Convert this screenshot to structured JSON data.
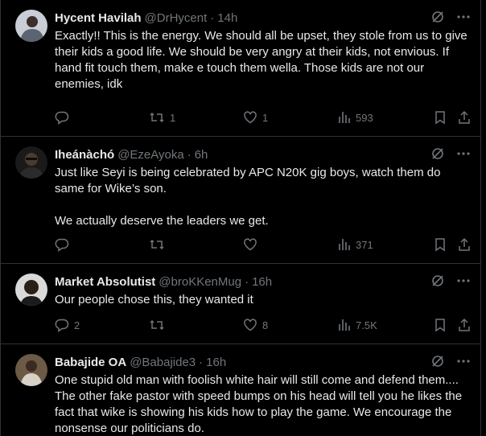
{
  "colors": {
    "background": "#000000",
    "text": "#e7e9ea",
    "muted": "#71767b",
    "border": "#2f3336"
  },
  "icons": {
    "grok": "grok-icon",
    "more": "more-icon",
    "reply": "reply-icon",
    "retweet": "retweet-icon",
    "like": "like-icon",
    "views": "views-icon",
    "bookmark": "bookmark-icon",
    "share": "share-icon"
  },
  "tweets": [
    {
      "name": "Hycent Havilah",
      "handle": "@DrHycent",
      "sep": "·",
      "time": "14h",
      "text": "Exactly!! This is the energy. We should all be upset, they stole from us to give their kids a good life. We should be very angry at their kids, not envious. If hand fit touch them, make e touch them wella. Those kids are not our enemies, idk",
      "replies": "",
      "retweets": "1",
      "likes": "1",
      "views": "593"
    },
    {
      "name": "Iheánàchó",
      "handle": "@EzeAyoka",
      "sep": "·",
      "time": "6h",
      "text": "Just like Seyi is being celebrated by APC N20K gig boys, watch them do same for Wike’s son.\n\nWe actually deserve the leaders we get.",
      "replies": "",
      "retweets": "",
      "likes": "",
      "views": "371"
    },
    {
      "name": "Market Absolutist",
      "handle": "@broKKenMug",
      "sep": "·",
      "time": "16h",
      "text": "Our people chose this, they wanted it",
      "replies": "2",
      "retweets": "",
      "likes": "8",
      "views": "7.5K"
    },
    {
      "name": "Babajide OA",
      "handle": "@Babajide3",
      "sep": "·",
      "time": "16h",
      "text": "One stupid old man with foolish white hair will still come and defend them.... The other fake pastor with speed bumps on his head will tell you he likes the fact that wike is showing his kids how to play the game. We encourage the nonsense our politicians do.",
      "replies": "",
      "retweets": "",
      "likes": "",
      "views": ""
    }
  ]
}
